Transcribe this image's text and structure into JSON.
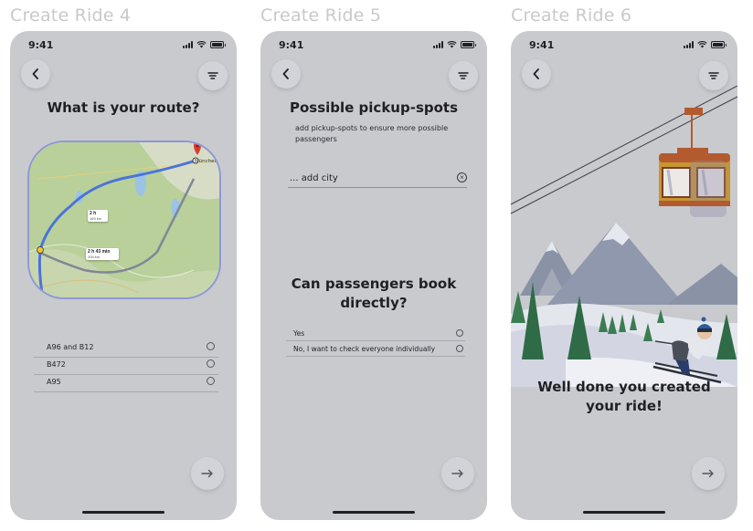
{
  "frames": [
    {
      "title": "Create Ride 4"
    },
    {
      "title": "Create Ride 5"
    },
    {
      "title": "Create Ride 6"
    }
  ],
  "status": {
    "time": "9:41"
  },
  "ride4": {
    "heading": "What is your route?",
    "map": {
      "badge1_time": "2 h",
      "badge1_dist": "169 km",
      "badge2_time": "2 h 43 min",
      "badge2_dist": "205 km",
      "city_label": "München"
    },
    "routes": [
      "A96 and B12",
      "B472",
      "A95"
    ]
  },
  "ride5": {
    "heading": "Possible pickup-spots",
    "subtext": "add pickup-spots to ensure more possible passengers",
    "city_placeholder": "... add city",
    "question": "Can passengers book directly?",
    "options": [
      "Yes",
      "No, I want to check everyone individually"
    ]
  },
  "ride6": {
    "message": "Well done you created your ride!"
  },
  "colors": {
    "screen_bg": "#c9cace",
    "map_border": "#8f98d6",
    "route_blue": "#4a74d9",
    "text": "#1f1f24"
  },
  "icons": {
    "back": "chevron-left-icon",
    "filter": "filter-icon",
    "next": "arrow-right-icon",
    "clear": "clear-circle-icon"
  }
}
